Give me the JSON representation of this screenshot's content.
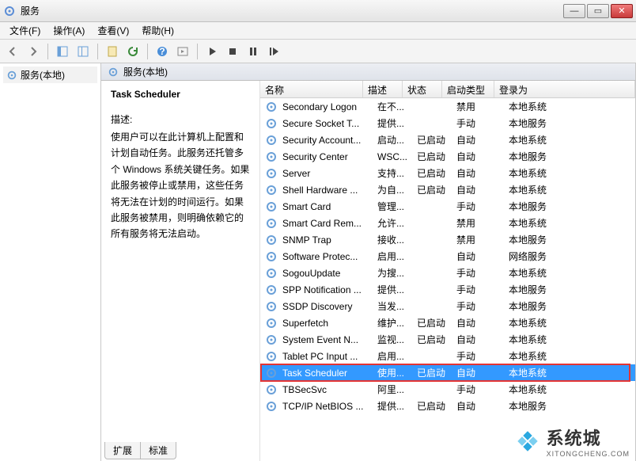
{
  "window": {
    "title": "服务"
  },
  "menu": {
    "file": "文件(F)",
    "action": "操作(A)",
    "view": "查看(V)",
    "help": "帮助(H)"
  },
  "nav": {
    "root": "服务(本地)"
  },
  "centerHeader": "服务(本地)",
  "description": {
    "title": "Task Scheduler",
    "label": "描述:",
    "text": "使用户可以在此计算机上配置和计划自动任务。此服务还托管多个 Windows 系统关键任务。如果此服务被停止或禁用，这些任务将无法在计划的时间运行。如果此服务被禁用，则明确依赖它的所有服务将无法启动。"
  },
  "columns": {
    "name": "名称",
    "desc": "描述",
    "status": "状态",
    "startup": "启动类型",
    "logon": "登录为"
  },
  "rows": [
    {
      "name": "Secondary Logon",
      "desc": "在不...",
      "status": "",
      "startup": "禁用",
      "logon": "本地系统"
    },
    {
      "name": "Secure Socket T...",
      "desc": "提供...",
      "status": "",
      "startup": "手动",
      "logon": "本地服务"
    },
    {
      "name": "Security Account...",
      "desc": "启动...",
      "status": "已启动",
      "startup": "自动",
      "logon": "本地系统"
    },
    {
      "name": "Security Center",
      "desc": "WSC...",
      "status": "已启动",
      "startup": "自动",
      "logon": "本地服务"
    },
    {
      "name": "Server",
      "desc": "支持...",
      "status": "已启动",
      "startup": "自动",
      "logon": "本地系统"
    },
    {
      "name": "Shell Hardware ...",
      "desc": "为自...",
      "status": "已启动",
      "startup": "自动",
      "logon": "本地系统"
    },
    {
      "name": "Smart Card",
      "desc": "管理...",
      "status": "",
      "startup": "手动",
      "logon": "本地服务"
    },
    {
      "name": "Smart Card Rem...",
      "desc": "允许...",
      "status": "",
      "startup": "禁用",
      "logon": "本地系统"
    },
    {
      "name": "SNMP Trap",
      "desc": "接收...",
      "status": "",
      "startup": "禁用",
      "logon": "本地服务"
    },
    {
      "name": "Software Protec...",
      "desc": "启用...",
      "status": "",
      "startup": "自动",
      "logon": "网络服务"
    },
    {
      "name": "SogouUpdate",
      "desc": "为搜...",
      "status": "",
      "startup": "手动",
      "logon": "本地系统"
    },
    {
      "name": "SPP Notification ...",
      "desc": "提供...",
      "status": "",
      "startup": "手动",
      "logon": "本地服务"
    },
    {
      "name": "SSDP Discovery",
      "desc": "当发...",
      "status": "",
      "startup": "手动",
      "logon": "本地服务"
    },
    {
      "name": "Superfetch",
      "desc": "维护...",
      "status": "已启动",
      "startup": "自动",
      "logon": "本地系统"
    },
    {
      "name": "System Event N...",
      "desc": "监视...",
      "status": "已启动",
      "startup": "自动",
      "logon": "本地系统"
    },
    {
      "name": "Tablet PC Input ...",
      "desc": "启用...",
      "status": "",
      "startup": "手动",
      "logon": "本地系统"
    },
    {
      "name": "Task Scheduler",
      "desc": "使用...",
      "status": "已启动",
      "startup": "自动",
      "logon": "本地系统",
      "selected": true
    },
    {
      "name": "TBSecSvc",
      "desc": "阿里...",
      "status": "",
      "startup": "手动",
      "logon": "本地系统"
    },
    {
      "name": "TCP/IP NetBIOS ...",
      "desc": "提供...",
      "status": "已启动",
      "startup": "自动",
      "logon": "本地服务"
    }
  ],
  "tabs": {
    "extended": "扩展",
    "standard": "标准"
  },
  "watermark": {
    "name": "系统城",
    "url": "XITONGCHENG.COM"
  }
}
